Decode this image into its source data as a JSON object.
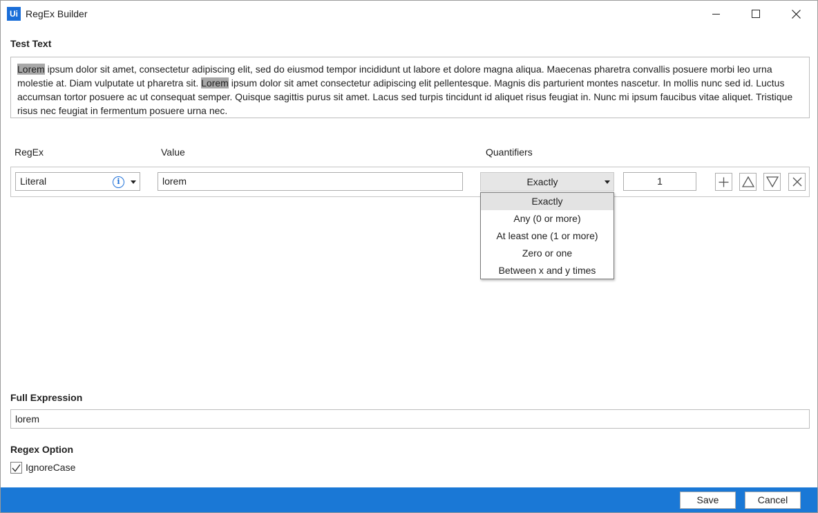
{
  "window": {
    "logo": "Ui",
    "title": "RegEx Builder"
  },
  "test_text": {
    "label": "Test Text",
    "match1": "Lorem",
    "part1": " ipsum dolor sit amet, consectetur adipiscing elit, sed do eiusmod tempor incididunt ut labore et dolore magna aliqua. Maecenas pharetra convallis posuere morbi leo urna molestie at. Diam vulputate ut pharetra sit. ",
    "match2": "Lorem",
    "part2": " ipsum dolor sit amet consectetur adipiscing elit pellentesque. Magnis dis parturient montes nascetur. In mollis nunc sed id. Luctus accumsan tortor posuere ac ut consequat semper. Quisque sagittis purus sit amet. Lacus sed turpis tincidunt id aliquet risus feugiat in. Nunc mi ipsum faucibus vitae aliquet. Tristique risus nec feugiat in fermentum posuere urna nec."
  },
  "columns": {
    "regex": "RegEx",
    "value": "Value",
    "quantifiers": "Quantifiers"
  },
  "rule": {
    "type": "Literal",
    "value": "lorem",
    "quantifier": "Exactly",
    "count": "1"
  },
  "quantifier_options": [
    "Exactly",
    "Any (0 or more)",
    "At least one (1 or more)",
    "Zero or one",
    "Between x and y times"
  ],
  "full_expression": {
    "label": "Full Expression",
    "value": "lorem"
  },
  "regex_option": {
    "label": "Regex Option",
    "ignore_case_label": "IgnoreCase",
    "ignore_case_checked": true
  },
  "footer": {
    "save": "Save",
    "cancel": "Cancel"
  },
  "colors": {
    "accent": "#1a78d6",
    "highlight": "#a8a8a8"
  }
}
